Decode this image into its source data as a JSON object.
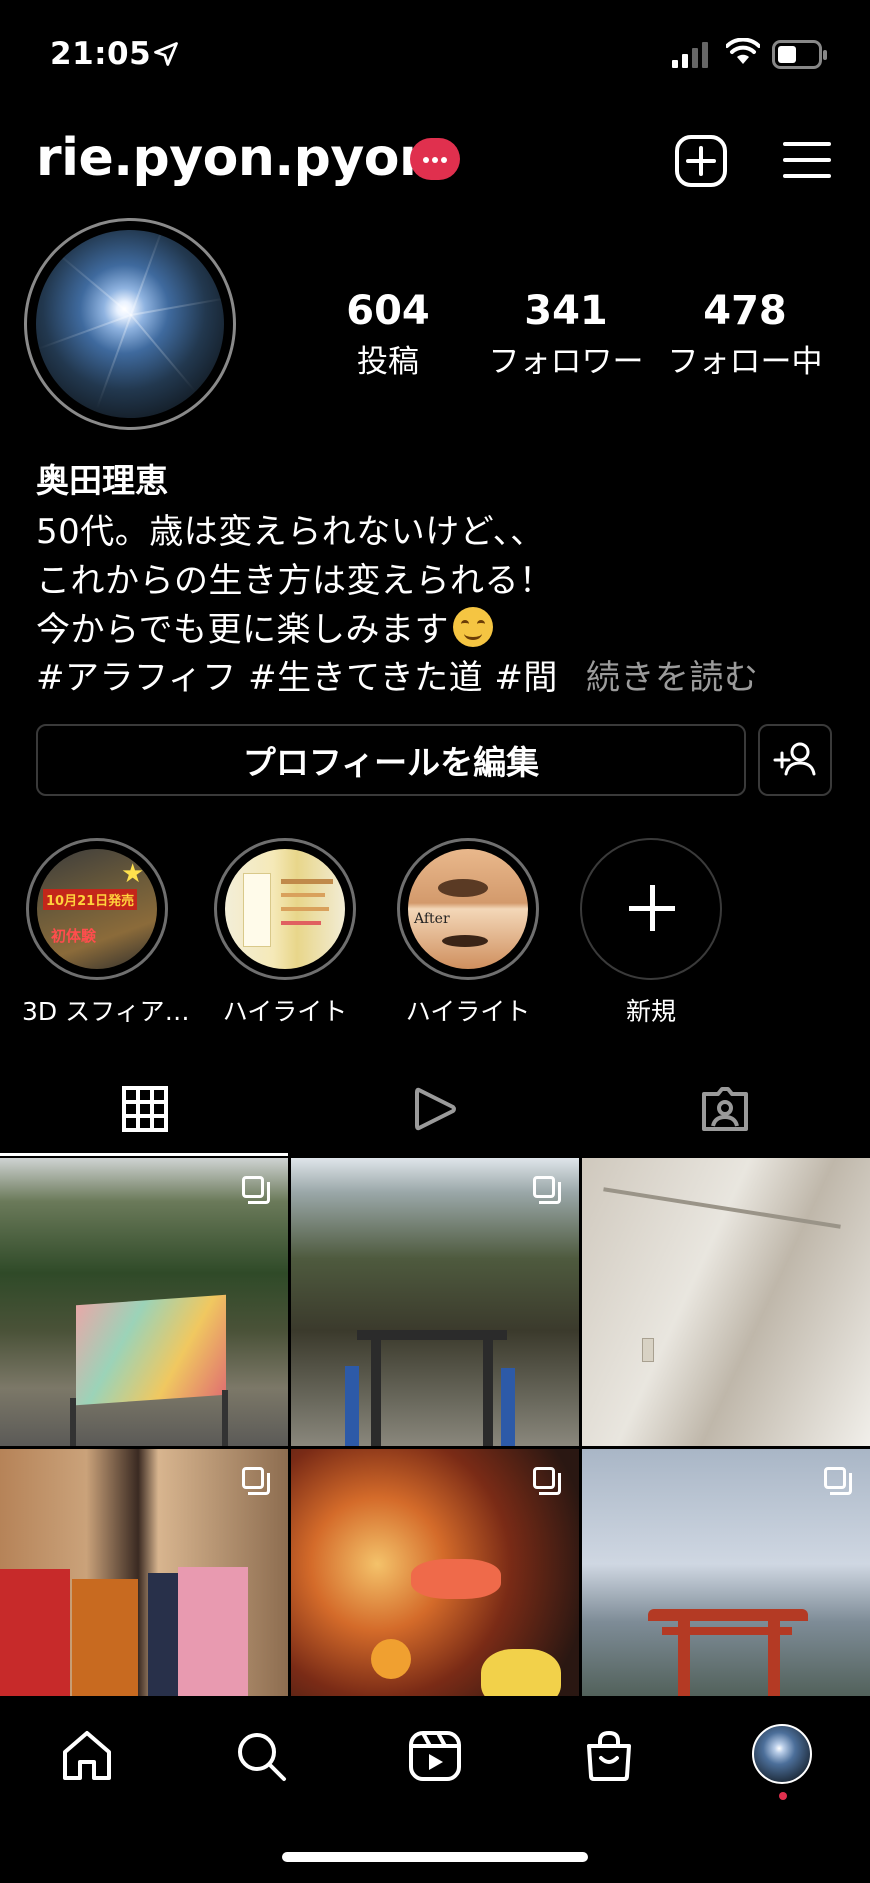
{
  "status_bar": {
    "time": "21:05"
  },
  "profile": {
    "username": "rie.pyon.pyon",
    "stats": [
      {
        "value": "604",
        "label": "投稿"
      },
      {
        "value": "341",
        "label": "フォロワー"
      },
      {
        "value": "478",
        "label": "フォロー中"
      }
    ],
    "name": "奥田理恵",
    "bio_lines": [
      "50代。歳は変えられないけど、、",
      "これからの生き方は変えられる！",
      "今からでも更に楽しみます",
      "#アラフィフ #生きてきた道 #間"
    ],
    "more_label": "続きを読む",
    "edit_button": "プロフィールを編集"
  },
  "highlights": [
    {
      "label": "3D スフィア…",
      "inner_text": "10月21日発売",
      "inner_sub": "初体験"
    },
    {
      "label": "ハイライト"
    },
    {
      "label": "ハイライト",
      "inner_text": "After"
    },
    {
      "label": "新規"
    }
  ],
  "tabs": [
    "grid",
    "reels",
    "tagged"
  ],
  "grid_posts": [
    {
      "id": "post-1",
      "multi": true
    },
    {
      "id": "post-2",
      "multi": true
    },
    {
      "id": "post-3",
      "multi": false
    },
    {
      "id": "post-4",
      "multi": true
    },
    {
      "id": "post-5",
      "multi": true
    },
    {
      "id": "post-6",
      "multi": true
    }
  ],
  "colors": {
    "accent": "#e0304e",
    "background": "#000000",
    "muted": "#9b9b9b"
  }
}
